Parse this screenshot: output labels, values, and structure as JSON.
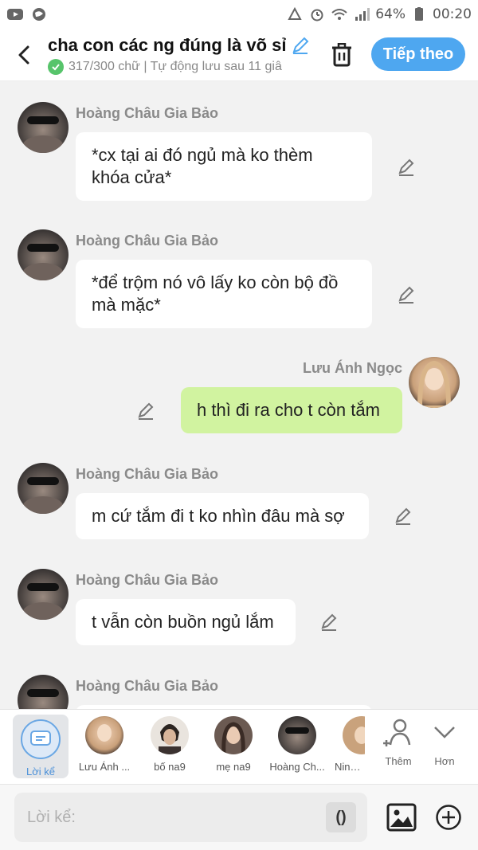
{
  "status_bar": {
    "battery": "64%",
    "time": "00:20",
    "icons": [
      "youtube-icon",
      "browser-icon",
      "recycle-icon",
      "alarm-icon",
      "wifi-icon",
      "signal-icon",
      "battery-icon"
    ]
  },
  "header": {
    "title": "cha con các ng đúng là võ sỉ",
    "subtitle": "317/300 chữ | Tự động lưu sau 11 giâ",
    "next_label": "Tiếp theo"
  },
  "messages": [
    {
      "sender": "Hoàng Châu Gia Bảo",
      "line1": "*cx tại ai đó ngủ mà ko thèm",
      "line2": "khóa cửa*",
      "mine": false
    },
    {
      "sender": "Hoàng Châu Gia Bảo",
      "line1": "*để trộm nó vô lấy ko còn bộ đồ",
      "line2": "mà mặc*",
      "mine": false
    },
    {
      "sender": "Lưu Ánh Ngọc",
      "line1": "h thì đi ra cho t còn tắm",
      "mine": true
    },
    {
      "sender": "Hoàng Châu Gia Bảo",
      "line1": "m cứ tắm đi t ko nhìn đâu mà sợ",
      "mine": false
    },
    {
      "sender": "Hoàng Châu Gia Bảo",
      "line1": "t vẫn còn buồn ngủ lắm",
      "mine": false
    },
    {
      "sender": "Hoàng Châu Gia Bảo",
      "line1": "",
      "mine": false
    }
  ],
  "characters": {
    "narrator": "Lời kể",
    "items": [
      "Lưu Ánh ...",
      "bố na9",
      "mẹ na9",
      "Hoàng Ch...",
      "Ninh N"
    ],
    "add_label": "Thêm",
    "more_label": "Hơn"
  },
  "input": {
    "placeholder": "Lời kể:",
    "paren_label": "()"
  },
  "colors": {
    "accent": "#4ea7f0",
    "my_bubble": "#d1f3a0",
    "other_bubble": "#ffffff",
    "background": "#f2f2f2"
  }
}
